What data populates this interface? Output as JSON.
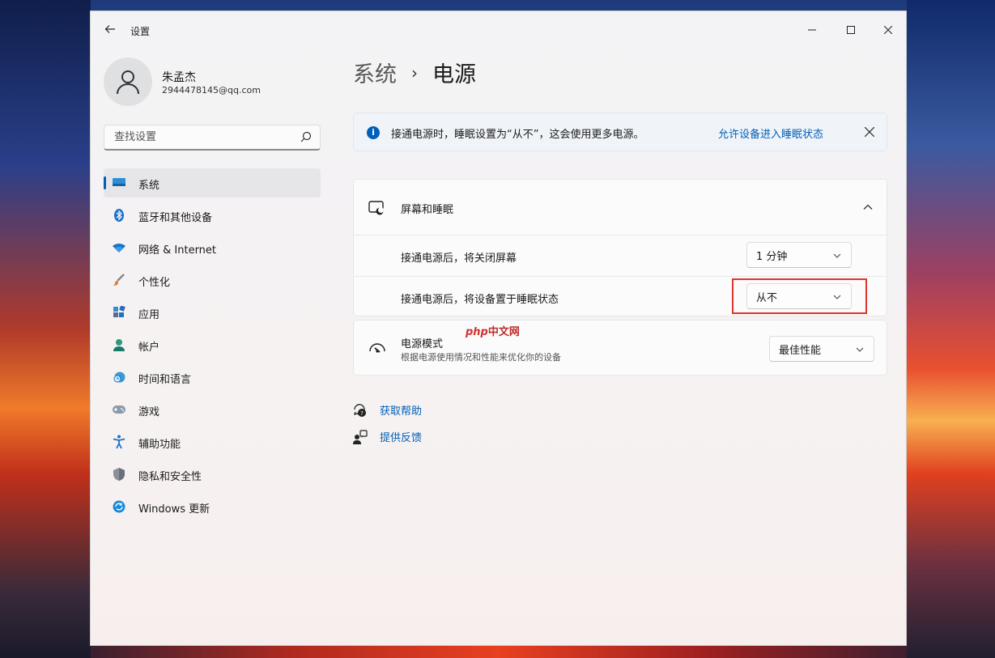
{
  "app": {
    "title": "设置"
  },
  "user": {
    "name": "朱孟杰",
    "email": "2944478145@qq.com"
  },
  "search": {
    "placeholder": "查找设置"
  },
  "sidebar": {
    "items": [
      {
        "label": "系统",
        "icon": "monitor-icon",
        "active": true
      },
      {
        "label": "蓝牙和其他设备",
        "icon": "bluetooth-icon"
      },
      {
        "label": "网络 & Internet",
        "icon": "wifi-icon"
      },
      {
        "label": "个性化",
        "icon": "brush-icon"
      },
      {
        "label": "应用",
        "icon": "apps-icon"
      },
      {
        "label": "帐户",
        "icon": "person-icon"
      },
      {
        "label": "时间和语言",
        "icon": "clock-globe-icon"
      },
      {
        "label": "游戏",
        "icon": "gamepad-icon"
      },
      {
        "label": "辅助功能",
        "icon": "accessibility-icon"
      },
      {
        "label": "隐私和安全性",
        "icon": "shield-icon"
      },
      {
        "label": "Windows 更新",
        "icon": "update-icon"
      }
    ]
  },
  "breadcrumb": {
    "parent": "系统",
    "separator": "›",
    "current": "电源"
  },
  "info_bar": {
    "text": "接通电源时，睡眠设置为“从不”，这会使用更多电源。",
    "link": "允许设备进入睡眠状态"
  },
  "screen_sleep": {
    "title": "屏幕和睡眠",
    "rows": [
      {
        "label": "接通电源后，将关闭屏幕",
        "value": "1 分钟"
      },
      {
        "label": "接通电源后，将设备置于睡眠状态",
        "value": "从不"
      }
    ]
  },
  "power_mode": {
    "title": "电源模式",
    "subtitle": "根据电源使用情况和性能来优化你的设备",
    "value": "最佳性能"
  },
  "watermark": {
    "php": "php",
    "cn": "中文网"
  },
  "help": {
    "get_help": "获取帮助",
    "feedback": "提供反馈"
  },
  "colors": {
    "accent": "#005fb8",
    "highlight": "#e0342a"
  }
}
